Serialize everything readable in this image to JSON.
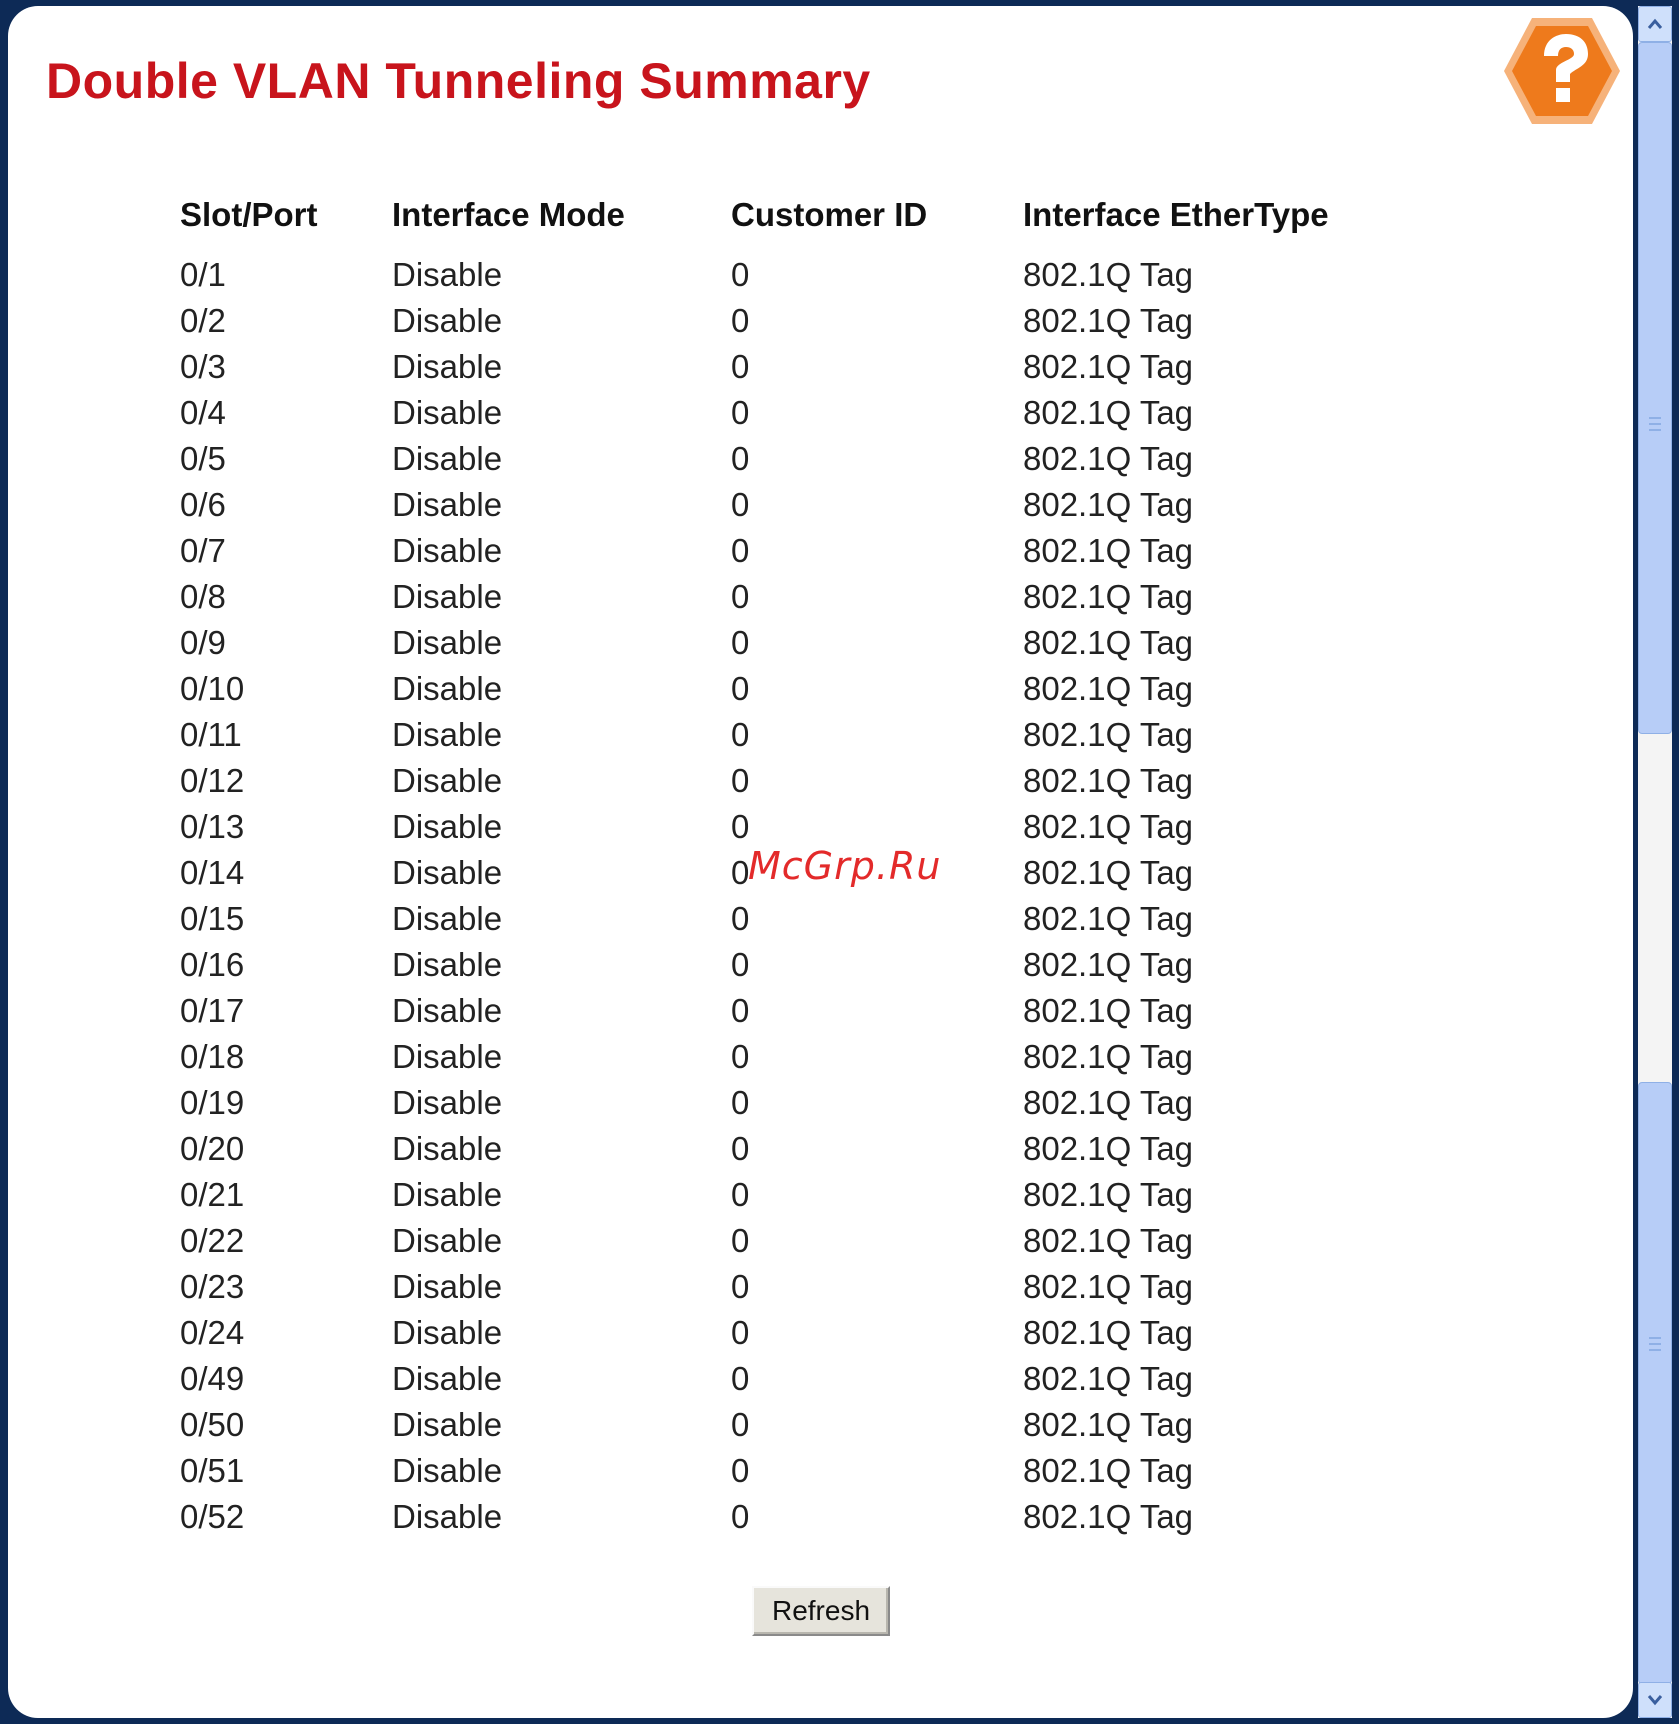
{
  "page": {
    "title": "Double VLAN Tunneling Summary",
    "help_icon": "help-question-icon"
  },
  "table": {
    "headers": [
      "Slot/Port",
      "Interface Mode",
      "Customer ID",
      "Interface EtherType"
    ],
    "rows": [
      [
        "0/1",
        "Disable",
        "0",
        "802.1Q Tag"
      ],
      [
        "0/2",
        "Disable",
        "0",
        "802.1Q Tag"
      ],
      [
        "0/3",
        "Disable",
        "0",
        "802.1Q Tag"
      ],
      [
        "0/4",
        "Disable",
        "0",
        "802.1Q Tag"
      ],
      [
        "0/5",
        "Disable",
        "0",
        "802.1Q Tag"
      ],
      [
        "0/6",
        "Disable",
        "0",
        "802.1Q Tag"
      ],
      [
        "0/7",
        "Disable",
        "0",
        "802.1Q Tag"
      ],
      [
        "0/8",
        "Disable",
        "0",
        "802.1Q Tag"
      ],
      [
        "0/9",
        "Disable",
        "0",
        "802.1Q Tag"
      ],
      [
        "0/10",
        "Disable",
        "0",
        "802.1Q Tag"
      ],
      [
        "0/11",
        "Disable",
        "0",
        "802.1Q Tag"
      ],
      [
        "0/12",
        "Disable",
        "0",
        "802.1Q Tag"
      ],
      [
        "0/13",
        "Disable",
        "0",
        "802.1Q Tag"
      ],
      [
        "0/14",
        "Disable",
        "0",
        "802.1Q Tag"
      ],
      [
        "0/15",
        "Disable",
        "0",
        "802.1Q Tag"
      ],
      [
        "0/16",
        "Disable",
        "0",
        "802.1Q Tag"
      ],
      [
        "0/17",
        "Disable",
        "0",
        "802.1Q Tag"
      ],
      [
        "0/18",
        "Disable",
        "0",
        "802.1Q Tag"
      ],
      [
        "0/19",
        "Disable",
        "0",
        "802.1Q Tag"
      ],
      [
        "0/20",
        "Disable",
        "0",
        "802.1Q Tag"
      ],
      [
        "0/21",
        "Disable",
        "0",
        "802.1Q Tag"
      ],
      [
        "0/22",
        "Disable",
        "0",
        "802.1Q Tag"
      ],
      [
        "0/23",
        "Disable",
        "0",
        "802.1Q Tag"
      ],
      [
        "0/24",
        "Disable",
        "0",
        "802.1Q Tag"
      ],
      [
        "0/49",
        "Disable",
        "0",
        "802.1Q Tag"
      ],
      [
        "0/50",
        "Disable",
        "0",
        "802.1Q Tag"
      ],
      [
        "0/51",
        "Disable",
        "0",
        "802.1Q Tag"
      ],
      [
        "0/52",
        "Disable",
        "0",
        "802.1Q Tag"
      ]
    ]
  },
  "actions": {
    "refresh_label": "Refresh"
  },
  "watermark": "McGrp.Ru",
  "colors": {
    "title": "#c8141c",
    "frame": "#0d2a56",
    "help_badge": "#f07a1e",
    "scrollbar": "#b7cdf7"
  }
}
